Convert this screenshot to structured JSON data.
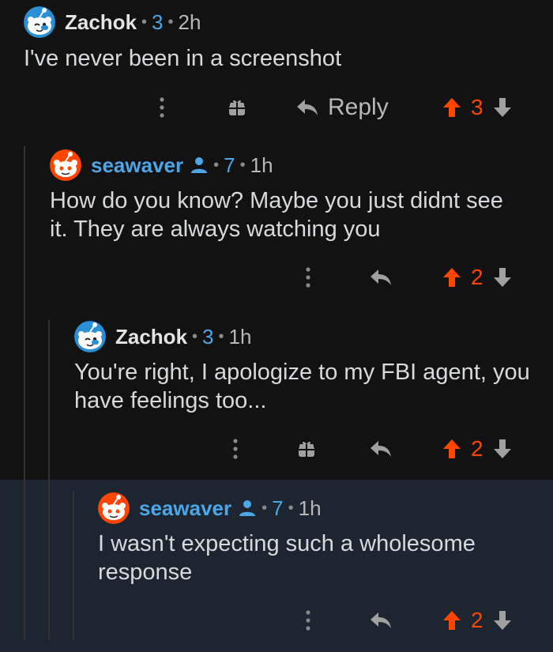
{
  "colors": {
    "background": "#121212",
    "highlight": "#1c2530",
    "upvote": "#ff4500",
    "username_blue": "#4da6e8",
    "text": "#d7dadc"
  },
  "comments": [
    {
      "username": "Zachok",
      "karma": "3",
      "age": "2h",
      "separator": "•",
      "avatar": "snoo-avatar-blue",
      "body": "I've never been in a screenshot",
      "reply_label": "Reply",
      "votes": "3"
    },
    {
      "username": "seawaver",
      "karma": "7",
      "age": "1h",
      "separator": "•",
      "avatar": "snoo-avatar-red",
      "op_badge": "person-icon",
      "body": "How do you know? Maybe you just didnt see\nit. They are always watching you",
      "votes": "2"
    },
    {
      "username": "Zachok",
      "karma": "3",
      "age": "1h",
      "separator": "•",
      "avatar": "snoo-avatar-blue",
      "body": "You're right, I apologize to my FBI agent, you\nhave feelings too...",
      "votes": "2"
    },
    {
      "username": "seawaver",
      "karma": "7",
      "age": "1h",
      "separator": "•",
      "avatar": "snoo-avatar-red",
      "op_badge": "person-icon",
      "body": "I wasn't expecting such a wholesome\nresponse",
      "votes": "2"
    }
  ],
  "icons": [
    "more-options-icon",
    "gift-icon",
    "reply-arrow-icon",
    "upvote-arrow-icon",
    "downvote-arrow-icon",
    "person-icon"
  ]
}
